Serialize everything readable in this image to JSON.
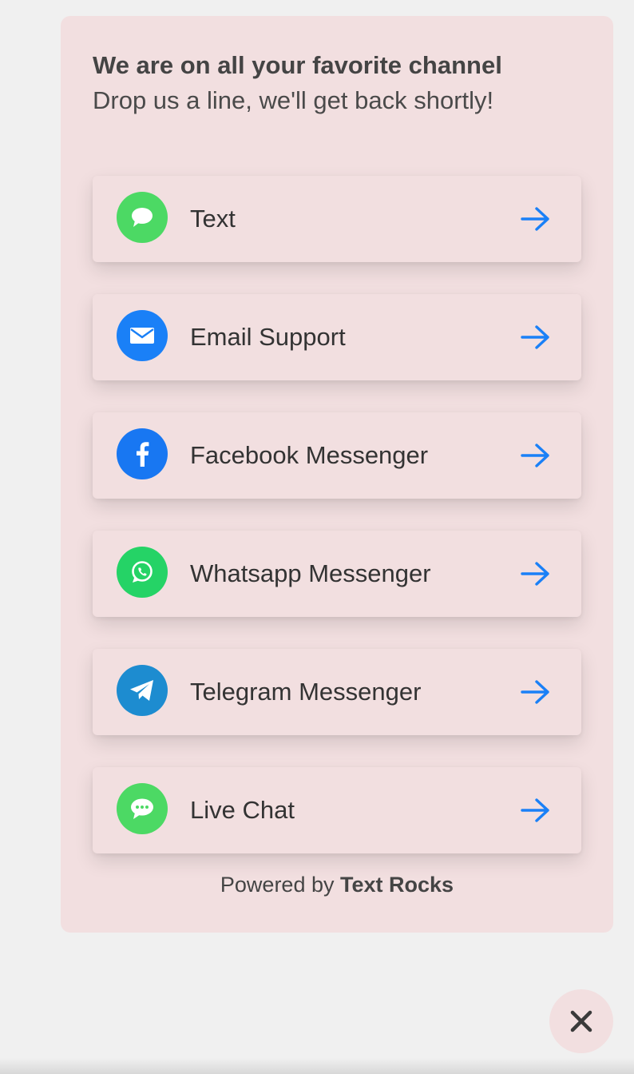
{
  "header": {
    "title": "We are on all your favorite channel",
    "subtitle": "Drop us a line, we'll get back shortly!"
  },
  "channels": [
    {
      "label": "Text",
      "icon": "sms-bubble-icon",
      "color": "#4cd964"
    },
    {
      "label": "Email Support",
      "icon": "envelope-icon",
      "color": "#1a80f7"
    },
    {
      "label": "Facebook Messenger",
      "icon": "facebook-icon",
      "color": "#1877f2"
    },
    {
      "label": "Whatsapp Messenger",
      "icon": "whatsapp-icon",
      "color": "#25d366"
    },
    {
      "label": "Telegram Messenger",
      "icon": "telegram-icon",
      "color": "#1d8cd0"
    },
    {
      "label": "Live Chat",
      "icon": "chat-bubble-icon",
      "color": "#4cd964"
    }
  ],
  "footer": {
    "powered_prefix": "Powered by",
    "powered_brand": "Text Rocks"
  },
  "colors": {
    "accent": "#1a80f7",
    "panel_bg": "#f2dfe0"
  },
  "close_icon": "close-icon"
}
